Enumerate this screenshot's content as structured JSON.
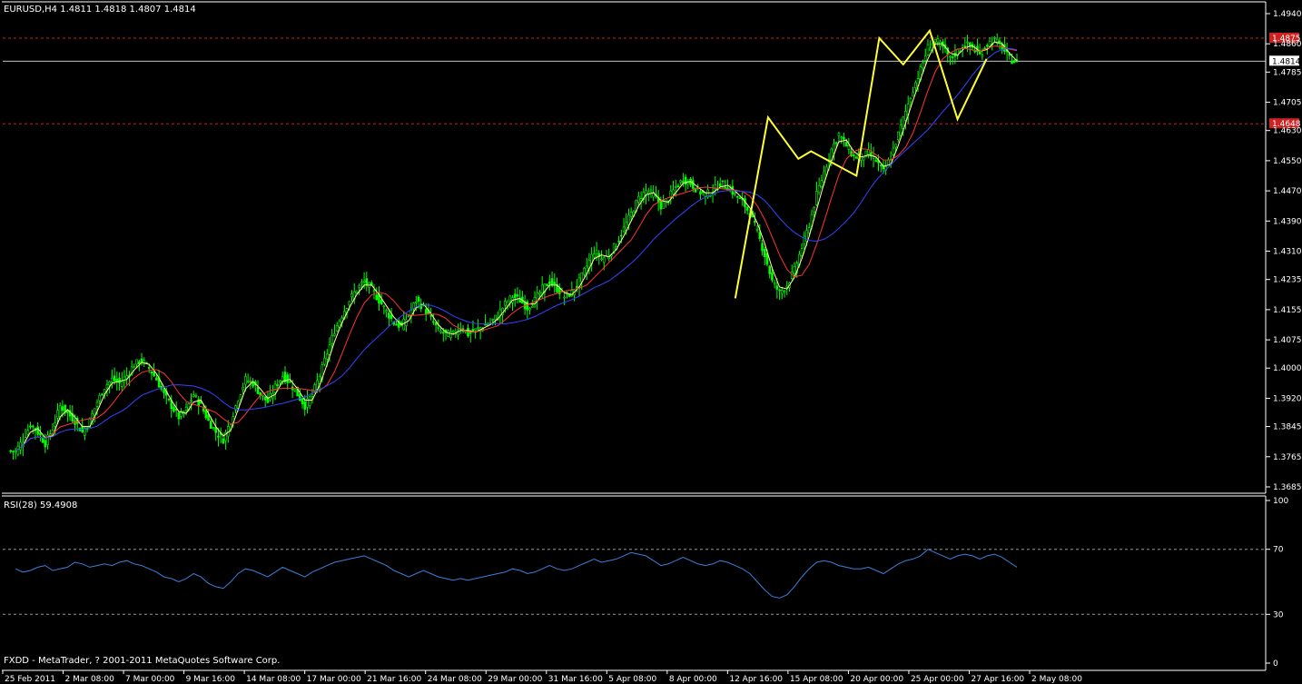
{
  "header": {
    "title": "EURUSD,H4",
    "ohlc": "1.4811 1.4818 1.4807 1.4814"
  },
  "footer": {
    "copyright": "FXDD - MetaTrader, ? 2001-2011 MetaQuotes Software Corp."
  },
  "colors": {
    "background": "#000000",
    "bull_candle": "#00ff00",
    "bear_candle": "#00ff00",
    "ma_fast": "#ffff99",
    "ma_mid": "#ff3333",
    "ma_slow": "#3344ff",
    "zigzag": "#ffff33",
    "rsi": "#3d7fd9",
    "level_line": "#cc2222",
    "grid_axis": "#ffffff"
  },
  "chart_data": [
    {
      "type": "candlestick",
      "symbol": "EURUSD",
      "timeframe": "H4",
      "title": "EURUSD,H4",
      "ylim": [
        1.3685,
        1.494
      ],
      "y_ticks": [
        "1.4940",
        "1.4860",
        "1.4785",
        "1.4705",
        "1.4630",
        "1.4550",
        "1.4470",
        "1.4390",
        "1.4310",
        "1.4235",
        "1.4155",
        "1.4075",
        "1.4000",
        "1.3920",
        "1.3845",
        "1.3765",
        "1.3685"
      ],
      "x_ticks": [
        "25 Feb 2011",
        "2 Mar 08:00",
        "7 Mar 00:00",
        "9 Mar 16:00",
        "14 Mar 08:00",
        "17 Mar 00:00",
        "21 Mar 16:00",
        "24 Mar 08:00",
        "29 Mar 00:00",
        "31 Mar 16:00",
        "5 Apr 08:00",
        "8 Apr 00:00",
        "12 Apr 16:00",
        "15 Apr 08:00",
        "20 Apr 00:00",
        "25 Apr 00:00",
        "27 Apr 16:00",
        "2 May 08:00"
      ],
      "current_price": "1.4814",
      "level_lines": [
        {
          "label": "1.4875",
          "value": 1.4875
        },
        {
          "label": "1.4648",
          "value": 1.4648
        }
      ],
      "close_series_approx": [
        1.378,
        1.381,
        1.385,
        1.383,
        1.38,
        1.384,
        1.39,
        1.388,
        1.386,
        1.383,
        1.386,
        1.391,
        1.395,
        1.397,
        1.396,
        1.398,
        1.401,
        1.402,
        1.4,
        1.397,
        1.393,
        1.39,
        1.387,
        1.389,
        1.393,
        1.39,
        1.386,
        1.383,
        1.381,
        1.386,
        1.392,
        1.397,
        1.396,
        1.393,
        1.391,
        1.395,
        1.398,
        1.396,
        1.393,
        1.39,
        1.393,
        1.398,
        1.404,
        1.41,
        1.414,
        1.418,
        1.421,
        1.423,
        1.421,
        1.418,
        1.415,
        1.412,
        1.411,
        1.414,
        1.418,
        1.416,
        1.413,
        1.41,
        1.409,
        1.409,
        1.411,
        1.409,
        1.41,
        1.411,
        1.412,
        1.414,
        1.417,
        1.419,
        1.418,
        1.416,
        1.418,
        1.421,
        1.423,
        1.421,
        1.419,
        1.42,
        1.423,
        1.427,
        1.431,
        1.429,
        1.43,
        1.433,
        1.437,
        1.441,
        1.445,
        1.447,
        1.446,
        1.443,
        1.445,
        1.448,
        1.45,
        1.449,
        1.447,
        1.446,
        1.447,
        1.449,
        1.448,
        1.446,
        1.444,
        1.441,
        1.436,
        1.43,
        1.423,
        1.42,
        1.422,
        1.426,
        1.432,
        1.438,
        1.446,
        1.452,
        1.458,
        1.462,
        1.459,
        1.456,
        1.456,
        1.457,
        1.455,
        1.452,
        1.456,
        1.462,
        1.468,
        1.474,
        1.479,
        1.485,
        1.487,
        1.485,
        1.482,
        1.484,
        1.486,
        1.485,
        1.483,
        1.486,
        1.487,
        1.485,
        1.482,
        1.481
      ],
      "zigzag_points_approx": [
        {
          "x": 0.58,
          "y": 1.4185
        },
        {
          "x": 0.606,
          "y": 1.4665
        },
        {
          "x": 0.63,
          "y": 1.4555
        },
        {
          "x": 0.64,
          "y": 1.4575
        },
        {
          "x": 0.676,
          "y": 1.451
        },
        {
          "x": 0.694,
          "y": 1.4875
        },
        {
          "x": 0.713,
          "y": 1.4805
        },
        {
          "x": 0.734,
          "y": 1.4895
        },
        {
          "x": 0.756,
          "y": 1.466
        },
        {
          "x": 0.779,
          "y": 1.482
        }
      ]
    },
    {
      "type": "line",
      "title": "RSI(28) 59.4908",
      "indicator": "RSI",
      "period": 28,
      "value": "59.4908",
      "ylim": [
        0,
        100
      ],
      "y_ticks": [
        "100",
        "70",
        "30",
        "0"
      ],
      "levels": [
        70,
        30
      ],
      "values_approx": [
        58,
        56,
        57,
        59,
        60,
        57,
        58,
        59,
        62,
        61,
        59,
        60,
        61,
        60,
        62,
        63,
        61,
        60,
        58,
        56,
        53,
        52,
        50,
        52,
        55,
        53,
        49,
        47,
        46,
        50,
        55,
        58,
        57,
        55,
        53,
        56,
        59,
        57,
        55,
        53,
        56,
        58,
        60,
        62,
        63,
        64,
        65,
        66,
        64,
        62,
        60,
        57,
        55,
        53,
        55,
        57,
        55,
        53,
        52,
        51,
        52,
        51,
        52,
        53,
        54,
        55,
        56,
        58,
        57,
        55,
        56,
        58,
        60,
        58,
        57,
        58,
        60,
        62,
        64,
        62,
        63,
        64,
        66,
        68,
        67,
        66,
        63,
        60,
        61,
        63,
        65,
        63,
        61,
        60,
        61,
        63,
        62,
        60,
        58,
        55,
        50,
        45,
        41,
        40,
        42,
        47,
        53,
        58,
        62,
        63,
        62,
        60,
        59,
        58,
        58,
        59,
        57,
        55,
        58,
        61,
        63,
        64,
        66,
        70,
        68,
        66,
        64,
        66,
        67,
        66,
        64,
        66,
        67,
        65,
        62,
        59
      ]
    }
  ]
}
